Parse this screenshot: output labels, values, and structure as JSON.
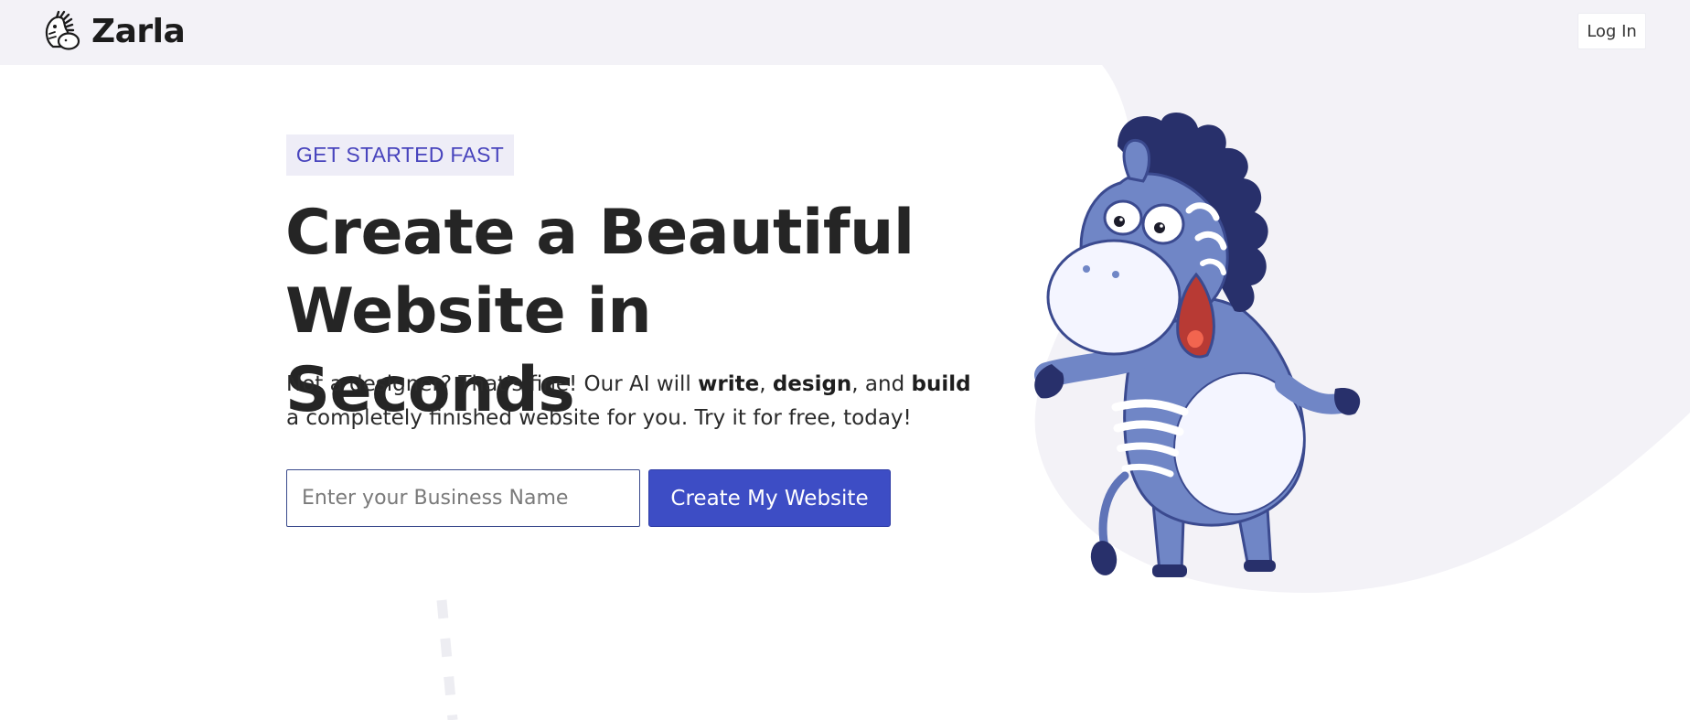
{
  "brand": {
    "name": "Zarla",
    "logo_icon": "zebra-logo-icon"
  },
  "header": {
    "login_label": "Log In"
  },
  "hero": {
    "eyebrow": "GET STARTED FAST",
    "headline_line1": "Create a Beautiful",
    "headline_line2": "Website in Seconds",
    "subtitle": {
      "part1": "Not a designer? That's fine! Our AI will ",
      "bold1": "write",
      "part2": ", ",
      "bold2": "design",
      "part3": ", and ",
      "bold3": "build",
      "part4": " a completely finished website for you. Try it for free, today!"
    },
    "input_placeholder": "Enter your Business Name",
    "input_value": "",
    "cta_label": "Create My Website",
    "illustration": "zebra-mascot-illustration"
  },
  "colors": {
    "accent": "#3d4dc5",
    "eyebrow_text": "#4844bd",
    "eyebrow_bg": "#eeedf7",
    "header_bg": "#f3f2f7",
    "zebra_body": "#7086c6",
    "zebra_dark": "#28306b"
  }
}
